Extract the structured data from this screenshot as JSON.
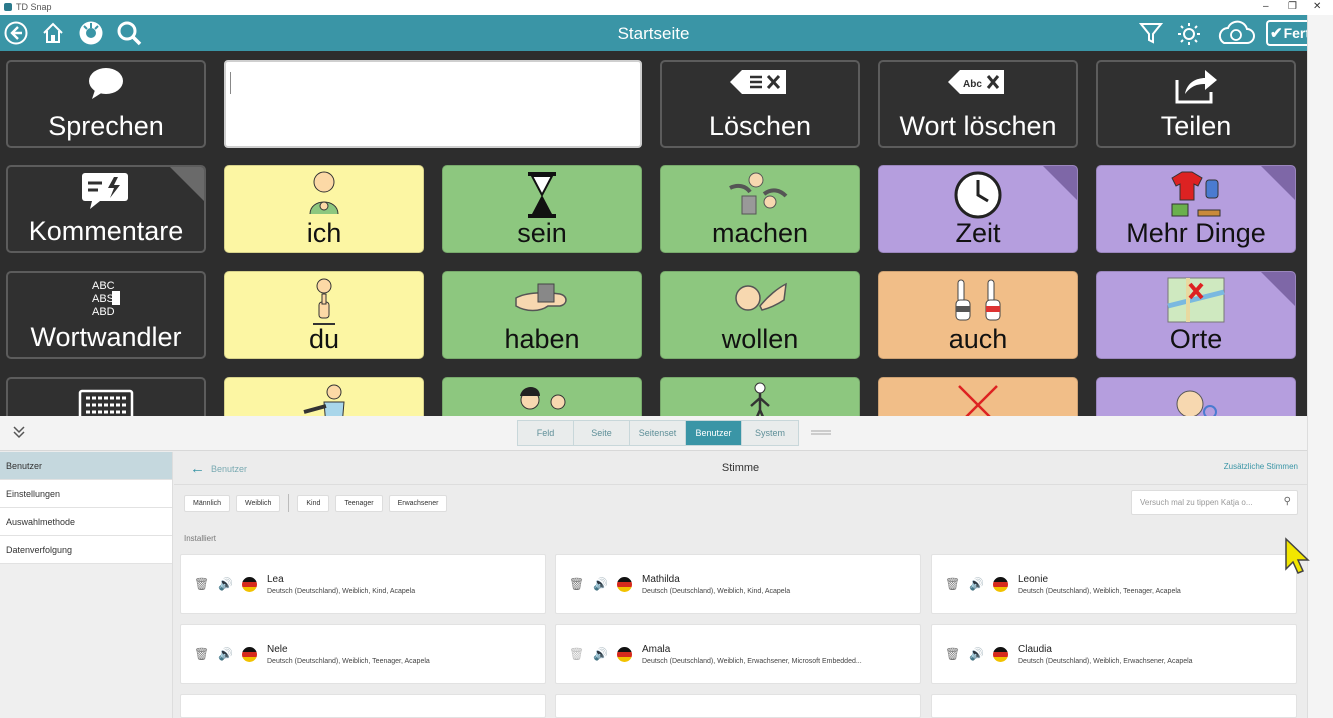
{
  "window": {
    "title": "TD Snap",
    "controls": [
      "–",
      "❐",
      "✕"
    ]
  },
  "topbar": {
    "title": "Startseite",
    "done_label": "Fertig",
    "icons": [
      "back-circle-icon",
      "home-icon",
      "dashboard-icon",
      "search-icon",
      "filter-icon",
      "brightness-icon",
      "cloud-sync-icon",
      "check-icon"
    ]
  },
  "message_bar": {
    "text": ""
  },
  "tools": [
    {
      "label": "Sprechen",
      "icon": "speech-bubble-icon"
    },
    {
      "label": "Löschen",
      "icon": "clear-icon"
    },
    {
      "label": "Wort löschen",
      "icon": "delete-word-icon"
    },
    {
      "label": "Teilen",
      "icon": "share-icon"
    }
  ],
  "grid": {
    "rows": [
      [
        {
          "label": "Kommentare",
          "color": "dark",
          "icon": "comment-icon",
          "folder": true
        },
        {
          "label": "ich",
          "color": "yellow",
          "icon": "person-me-icon"
        },
        {
          "label": "sein",
          "color": "green",
          "icon": "hourglass-icon"
        },
        {
          "label": "machen",
          "color": "green",
          "icon": "hands-working-icon"
        },
        {
          "label": "Zeit",
          "color": "purple",
          "icon": "clock-icon",
          "folder": true
        },
        {
          "label": "Mehr Dinge",
          "color": "purple",
          "icon": "objects-icon",
          "folder": true
        }
      ],
      [
        {
          "label": "Wortwandler",
          "color": "dark",
          "icon": "word-changer-icon"
        },
        {
          "label": "du",
          "color": "yellow",
          "icon": "person-you-icon"
        },
        {
          "label": "haben",
          "color": "green",
          "icon": "hand-holding-icon"
        },
        {
          "label": "wollen",
          "color": "green",
          "icon": "wanting-icon"
        },
        {
          "label": "auch",
          "color": "orange",
          "icon": "two-fingers-icon"
        },
        {
          "label": "Orte",
          "color": "purple",
          "icon": "map-icon",
          "folder": true
        }
      ],
      [
        {
          "label": "",
          "color": "dark",
          "icon": "keyboard-icon"
        },
        {
          "label": "",
          "color": "yellow",
          "icon": "person-pointing-icon"
        },
        {
          "label": "",
          "color": "green",
          "icon": "people-icon"
        },
        {
          "label": "",
          "color": "green",
          "icon": "person-walking-icon"
        },
        {
          "label": "",
          "color": "orange",
          "icon": "red-x-icon"
        },
        {
          "label": "",
          "color": "purple",
          "icon": "face-thinking-icon"
        }
      ]
    ]
  },
  "panel": {
    "tabs": [
      "Feld",
      "Seite",
      "Seitenset",
      "Benutzer",
      "System"
    ],
    "active_tab": "Benutzer",
    "sidebar": [
      "Benutzer",
      "Einstellungen",
      "Auswahlmethode",
      "Datenverfolgung"
    ],
    "active_sidebar": "Benutzer",
    "back_label": "Benutzer",
    "title": "Stimme",
    "extra_link": "Zusätzliche Stimmen",
    "filters": [
      "Männlich",
      "Weiblich",
      "Kind",
      "Teenager",
      "Erwachsener"
    ],
    "search_placeholder": "Versuch mal zu tippen Katja o...",
    "section": "Installiert",
    "voices": [
      {
        "name": "Lea",
        "desc": "Deutsch (Deutschland), Weiblich, Kind, Acapela"
      },
      {
        "name": "Mathilda",
        "desc": "Deutsch (Deutschland), Weiblich, Kind, Acapela"
      },
      {
        "name": "Leonie",
        "desc": "Deutsch (Deutschland), Weiblich, Teenager, Acapela"
      },
      {
        "name": "Nele",
        "desc": "Deutsch (Deutschland), Weiblich, Teenager, Acapela"
      },
      {
        "name": "Amala",
        "desc": "Deutsch (Deutschland), Weiblich, Erwachsener, Microsoft Embedded..."
      },
      {
        "name": "Claudia",
        "desc": "Deutsch (Deutschland), Weiblich, Erwachsener, Acapela"
      }
    ]
  },
  "colors": {
    "accent": "#3a95a6",
    "grid_bg": "#2d2d2d",
    "yellow": "#fcf6a3",
    "green": "#8dc77f",
    "purple": "#b59ede",
    "orange": "#f1be88",
    "dark": "#303030"
  }
}
